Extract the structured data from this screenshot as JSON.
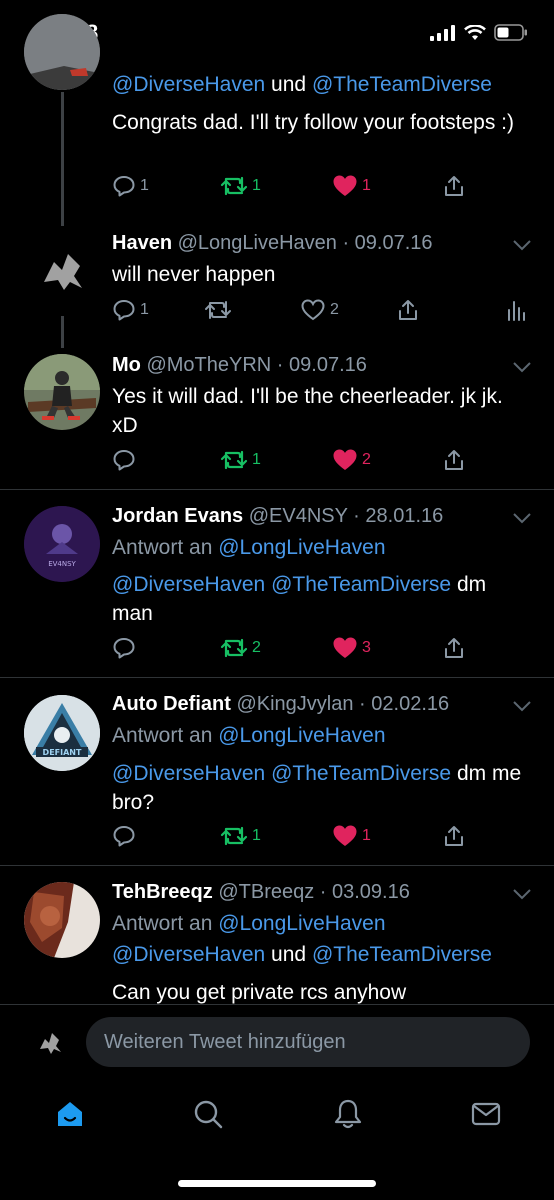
{
  "status_bar": {
    "time": "19:18"
  },
  "tweets": [
    {
      "mention_line": [
        "@DiverseHaven",
        " und ",
        "@TheTeamDiverse"
      ],
      "text": "Congrats dad. I'll try follow your footsteps :)",
      "replies": "1",
      "retweets": "1",
      "likes": "1"
    },
    {
      "name": "Haven",
      "handle": "@LongLiveHaven",
      "date": "09.07.16",
      "text": "will never happen",
      "replies": "1",
      "retweets": "",
      "likes": "2"
    },
    {
      "name": "Mo",
      "handle": "@MoTheYRN",
      "date": "09.07.16",
      "text": "Yes it will dad. I'll be the cheerleader. jk jk. xD",
      "replies": "",
      "retweets": "1",
      "likes": "2"
    },
    {
      "name": "Jordan Evans",
      "handle": "@EV4NSY",
      "date": "28.01.16",
      "reply_prefix": "Antwort an",
      "reply_to": "@LongLiveHaven",
      "mentions": [
        "@DiverseHaven",
        "@TheTeamDiverse"
      ],
      "text": "dm man",
      "avatar_text": "EV4NSY",
      "replies": "",
      "retweets": "2",
      "likes": "3"
    },
    {
      "name": "Auto Defiant",
      "handle": "@KingJvylan",
      "date": "02.02.16",
      "reply_prefix": "Antwort an",
      "reply_to": "@LongLiveHaven",
      "mentions": [
        "@DiverseHaven",
        "@TheTeamDiverse"
      ],
      "text": "dm me bro?",
      "avatar_text": "DEFIANT",
      "replies": "",
      "retweets": "1",
      "likes": "1"
    },
    {
      "name": "TehBreeqz",
      "handle": "@TBreeqz",
      "date": "03.09.16",
      "reply_prefix": "Antwort an",
      "reply_to": "@LongLiveHaven",
      "mention_line": [
        "@DiverseHaven",
        " und ",
        "@TheTeamDiverse"
      ],
      "text": "Can you get private rcs anyhow"
    }
  ],
  "compose": {
    "placeholder": "Weiteren Tweet hinzufügen"
  },
  "tabbar": {
    "items": [
      "home-icon",
      "search-icon",
      "bell-icon",
      "mail-icon"
    ]
  },
  "colors": {
    "link": "#4a99e9",
    "retweet": "#17bf63",
    "like": "#e0245e",
    "meta": "#8b98a5"
  }
}
